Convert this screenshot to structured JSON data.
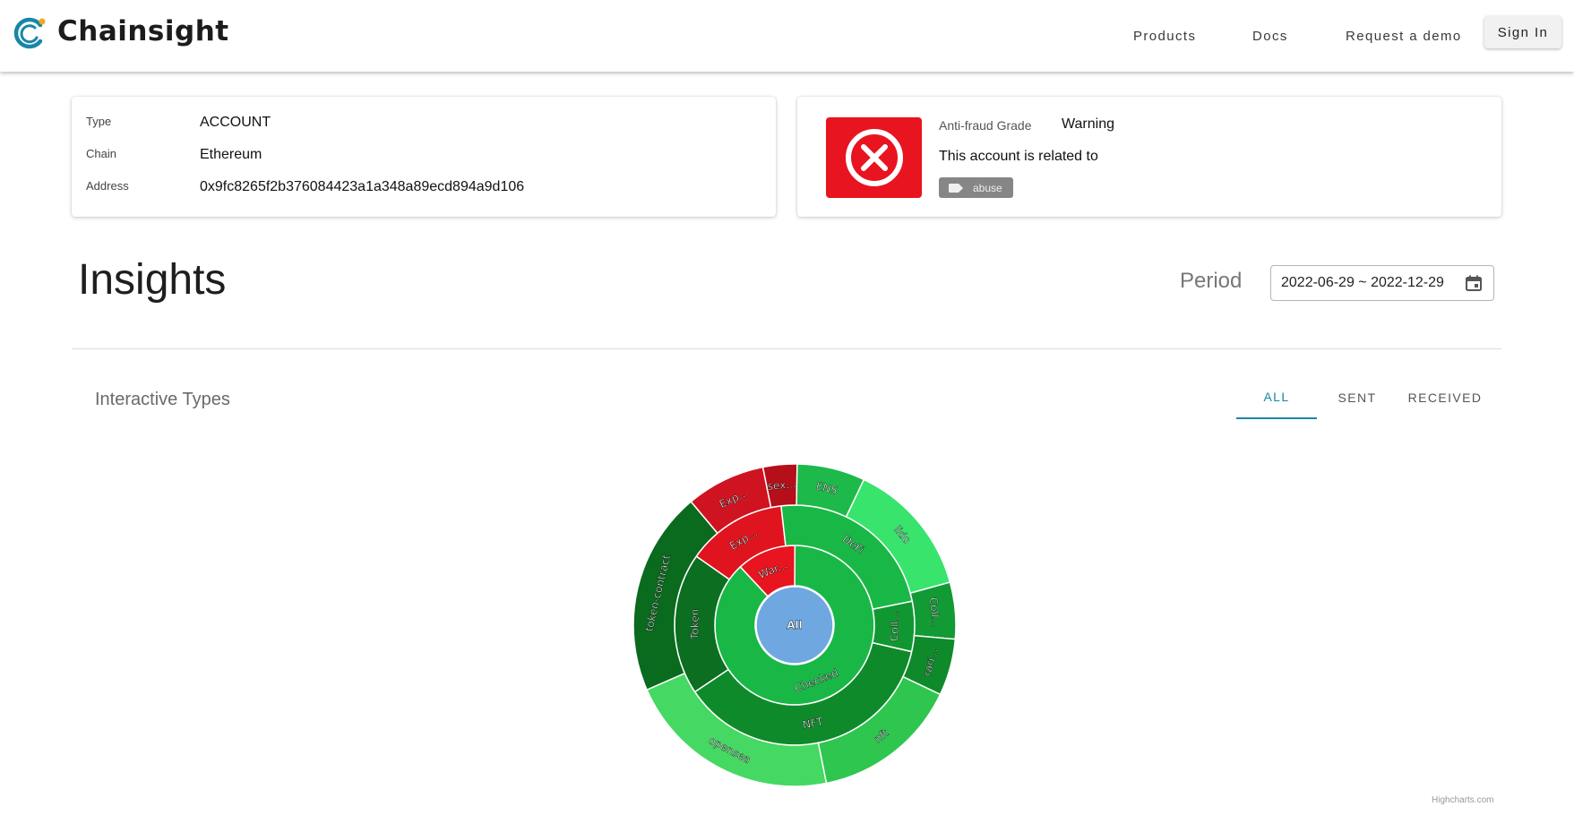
{
  "header": {
    "brand": "Chainsight",
    "nav": {
      "products": "Products",
      "docs": "Docs",
      "demo": "Request a demo"
    },
    "sign_in": "Sign In",
    "colors": {
      "logo_teal": "#1a86a6",
      "logo_orange": "#f0a820"
    }
  },
  "account": {
    "type_label": "Type",
    "type_value": "ACCOUNT",
    "chain_label": "Chain",
    "chain_value": "Ethereum",
    "address_label": "Address",
    "address_value": "0x9fc8265f2b376084423a1a348a89ecd894a9d106"
  },
  "fraud": {
    "icon": "x-circle-icon",
    "grade_label": "Anti-fraud Grade",
    "grade_value": "Warning",
    "related_text": "This account is related to",
    "tag": "abuse",
    "warning_color": "#e8141f"
  },
  "insights": {
    "title": "Insights",
    "period_label": "Period",
    "period_value": "2022-06-29 ~ 2022-12-29"
  },
  "interactive": {
    "title": "Interactive Types",
    "tabs": [
      "ALL",
      "SENT",
      "RECEIVED"
    ],
    "active_tab": "ALL"
  },
  "chart_data": {
    "type": "sunburst",
    "center": "All",
    "inner_ring": [
      {
        "name": "War...",
        "value": 12,
        "color": "#e8141f"
      },
      {
        "name": "Checked",
        "value": 88,
        "color": "#19b846"
      }
    ],
    "middle_ring": [
      {
        "name": "Exp...",
        "parent": "War...",
        "value": 12,
        "color": "#e0141e"
      },
      {
        "name": "DeFi",
        "parent": "Checked",
        "value": 21,
        "color": "#19b846"
      },
      {
        "name": "Coll...",
        "parent": "Checked",
        "value": 6,
        "color": "#119732"
      },
      {
        "name": "NFT",
        "parent": "Checked",
        "value": 33,
        "color": "#0f8a2a"
      },
      {
        "name": "Token",
        "parent": "Checked",
        "value": 17,
        "color": "#0b6e21"
      }
    ],
    "outer_ring": [
      {
        "name": "Exp...",
        "value": 7,
        "color": "#d01320"
      },
      {
        "name": "sex...",
        "value": 3,
        "color": "#b50f1a"
      },
      {
        "name": "ENS",
        "value": 6,
        "color": "#1db94a"
      },
      {
        "name": "lido",
        "value": 12,
        "color": "#38e46c"
      },
      {
        "name": "Coll...",
        "value": 5,
        "color": "#129a35"
      },
      {
        "name": "rari...",
        "value": 5,
        "color": "#0e8a2b"
      },
      {
        "name": "nft",
        "value": 13,
        "color": "#2ec64f"
      },
      {
        "name": "opensea",
        "value": 19,
        "color": "#45d862"
      },
      {
        "name": "token-contract",
        "value": 18,
        "color": "#0a6a1e"
      }
    ],
    "credits": "Highcharts.com"
  }
}
